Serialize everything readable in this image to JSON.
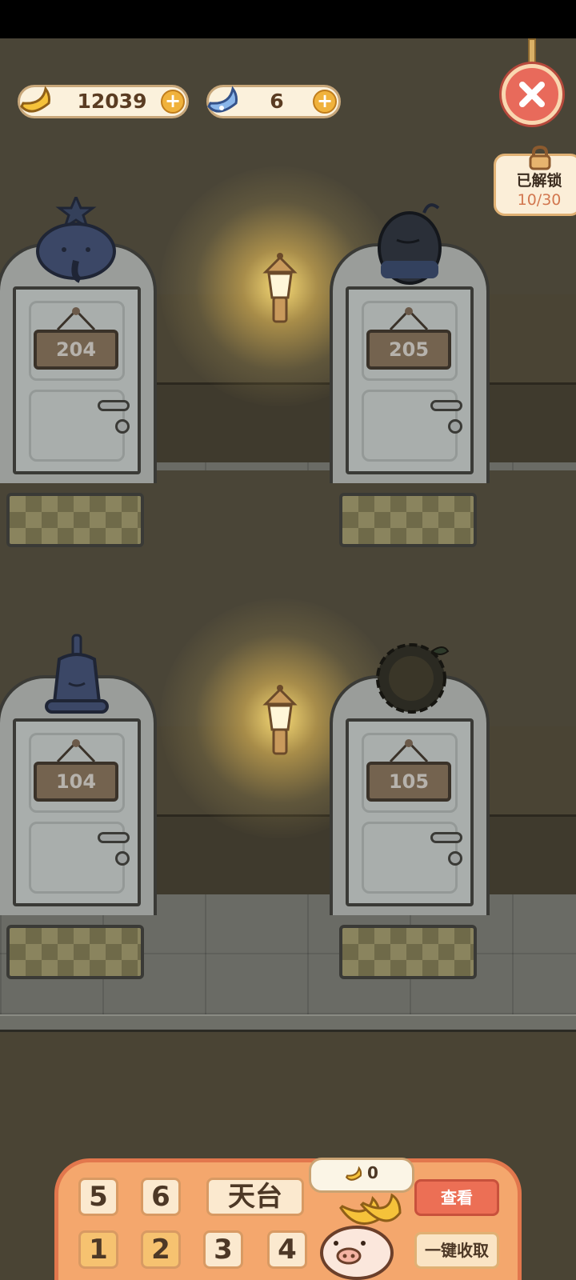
{
  "hud": {
    "banana_count": "12039",
    "gem_count": "6",
    "unlock_label": "已解锁",
    "unlock_progress": "10/30"
  },
  "rooms": [
    {
      "number": "204",
      "character": "elephant-icon"
    },
    {
      "number": "205",
      "character": "seed-blob-icon"
    },
    {
      "number": "104",
      "character": "bell-icon"
    },
    {
      "number": "105",
      "character": "sunflower-icon"
    }
  ],
  "panel": {
    "floors_row1": [
      "5",
      "6",
      "天台"
    ],
    "floors_row2": [
      "1",
      "2",
      "3",
      "4"
    ],
    "coins": "0",
    "view_label": "查看",
    "collect_label": "一键收取"
  },
  "colors": {
    "accent": "#f4a76d",
    "close": "#e86a5b",
    "lamp_glow": "#ffd878"
  }
}
